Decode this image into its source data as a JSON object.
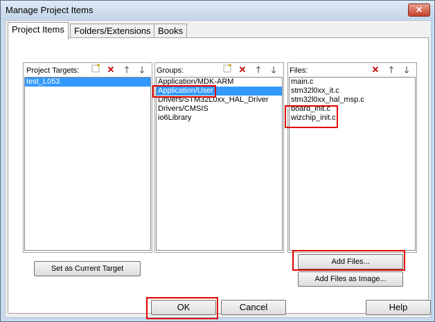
{
  "window": {
    "title": "Manage Project Items",
    "close_label": "✕"
  },
  "tabs": [
    {
      "label": "Project Items",
      "active": true
    },
    {
      "label": "Folders/Extensions",
      "active": false
    },
    {
      "label": "Books",
      "active": false
    }
  ],
  "targets": {
    "label": "Project Targets:",
    "items": [
      {
        "text": "test_L053",
        "selected": true
      }
    ],
    "set_current_button": "Set as Current Target"
  },
  "groups": {
    "label": "Groups:",
    "items": [
      {
        "text": "Application/MDK-ARM",
        "selected": false
      },
      {
        "text": "Application/User",
        "selected": true
      },
      {
        "text": "Drivers/STM32L0xx_HAL_Driver",
        "selected": false
      },
      {
        "text": "Drivers/CMSIS",
        "selected": false
      },
      {
        "text": "io6Library",
        "selected": false
      }
    ]
  },
  "files": {
    "label": "Files:",
    "items": [
      {
        "text": "main.c"
      },
      {
        "text": "stm32l0xx_it.c"
      },
      {
        "text": "stm32l0xx_hal_msp.c"
      },
      {
        "text": "board_init.c"
      },
      {
        "text": "wizchip_init.c"
      }
    ],
    "add_files_button": "Add Files...",
    "add_files_image_button": "Add Files as Image..."
  },
  "toolbar_icons": {
    "new": "new-item-icon",
    "delete": "delete-icon",
    "up": "move-up-icon",
    "down": "move-down-icon"
  },
  "footer": {
    "ok": "OK",
    "cancel": "Cancel",
    "help": "Help"
  },
  "colors": {
    "highlight": "#e00000",
    "selection": "#3399ff"
  }
}
